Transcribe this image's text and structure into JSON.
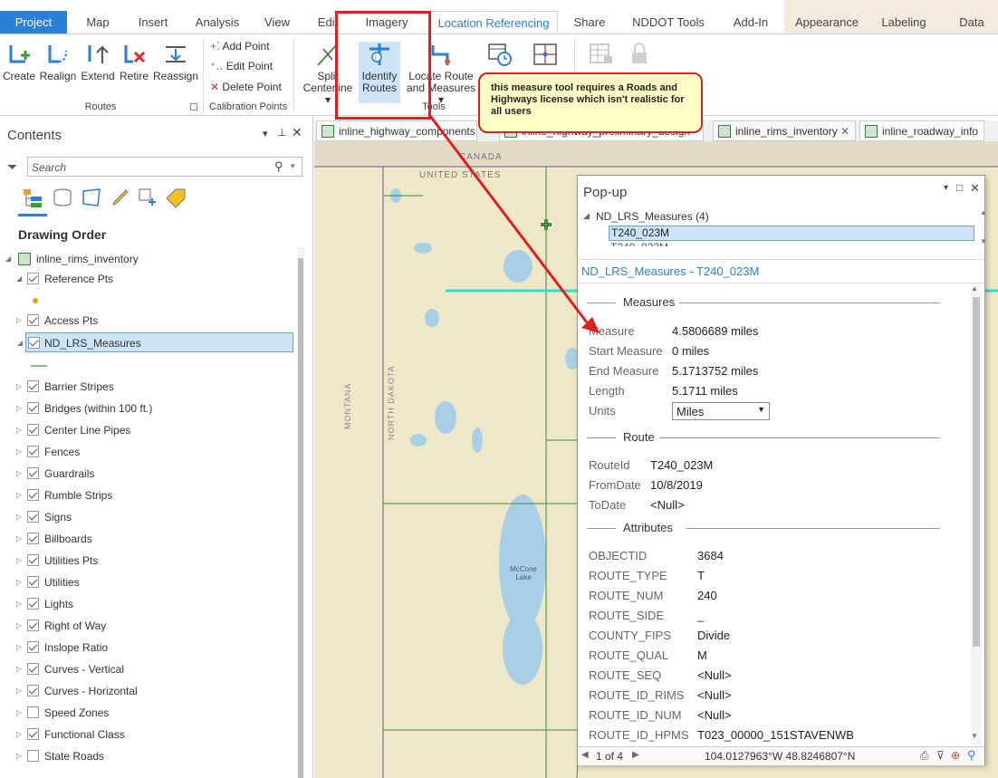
{
  "tabs": [
    "Project",
    "Map",
    "Insert",
    "Analysis",
    "View",
    "Edit",
    "Imagery",
    "Location Referencing",
    "Share",
    "NDDOT Tools",
    "Add-In",
    "Appearance",
    "Labeling",
    "Data"
  ],
  "ribbon": {
    "routes": [
      "Create",
      "Realign",
      "Extend",
      "Retire",
      "Reassign"
    ],
    "routes_group": "Routes",
    "calib": [
      "Add Point",
      "Edit Point",
      "Delete Point"
    ],
    "calib_group": "Calibration Points",
    "split": [
      "Split",
      "Centerline"
    ],
    "identify": [
      "Identify",
      "Routes"
    ],
    "locate": [
      "Locate Route",
      "and Measures"
    ],
    "tools_group": "Tools"
  },
  "callout": "this measure tool requires a Roads and Highways license which isn't realistic for all users",
  "contents": {
    "title": "Contents",
    "search_placeholder": "Search",
    "drawing_order": "Drawing Order",
    "map_name": "inline_rims_inventory",
    "layers": [
      {
        "label": "Reference Pts",
        "checked": true,
        "expanded": true
      },
      {
        "label": "Access Pts",
        "checked": true
      },
      {
        "label": "ND_LRS_Measures",
        "checked": true,
        "expanded": true,
        "selected": true
      },
      {
        "label": "Barrier Stripes",
        "checked": true
      },
      {
        "label": "Bridges (within 100 ft.)",
        "checked": true
      },
      {
        "label": "Center Line Pipes",
        "checked": true
      },
      {
        "label": "Fences",
        "checked": true
      },
      {
        "label": "Guardrails",
        "checked": true
      },
      {
        "label": "Rumble Strips",
        "checked": true
      },
      {
        "label": "Signs",
        "checked": true
      },
      {
        "label": "Billboards",
        "checked": true
      },
      {
        "label": "Utilities Pts",
        "checked": true
      },
      {
        "label": "Utilities",
        "checked": true
      },
      {
        "label": "Lights",
        "checked": true
      },
      {
        "label": "Right of Way",
        "checked": true
      },
      {
        "label": "Inslope Ratio",
        "checked": true
      },
      {
        "label": "Curves - Vertical",
        "checked": true
      },
      {
        "label": "Curves - Horizontal",
        "checked": true
      },
      {
        "label": "Speed Zones",
        "checked": false
      },
      {
        "label": "Functional Class",
        "checked": true
      },
      {
        "label": "State Roads",
        "checked": false
      }
    ]
  },
  "map_tabs": [
    "inline_highway_components",
    "inline_highway_preliminary_design",
    "inline_rims_inventory",
    "inline_roadway_info"
  ],
  "map_labels": {
    "canada": "CANADA",
    "us": "UNITED STATES",
    "montana": "MONTANA",
    "north_dakota": "NORTH DAKOTA",
    "lake": "McCone Lake"
  },
  "popup": {
    "title": "Pop-up",
    "tree_root": "ND_LRS_Measures  (4)",
    "tree_sel": "T240_023M",
    "header": "ND_LRS_Measures - T240_023M",
    "measures_title": "Measures",
    "measures": [
      {
        "label": "Measure",
        "value": "4.5806689 miles"
      },
      {
        "label": "Start Measure",
        "value": "0 miles"
      },
      {
        "label": "End Measure",
        "value": "5.1713752 miles"
      },
      {
        "label": "Length",
        "value": "5.1711 miles"
      }
    ],
    "units_label": "Units",
    "units_value": "Miles",
    "route_title": "Route",
    "route": [
      {
        "label": "RouteId",
        "value": "T240_023M"
      },
      {
        "label": "FromDate",
        "value": "10/8/2019"
      },
      {
        "label": "ToDate",
        "value": "<Null>"
      }
    ],
    "attr_title": "Attributes",
    "attributes": [
      {
        "label": "OBJECTID",
        "value": "3684"
      },
      {
        "label": "ROUTE_TYPE",
        "value": "T"
      },
      {
        "label": "ROUTE_NUM",
        "value": "240"
      },
      {
        "label": "ROUTE_SIDE",
        "value": "_"
      },
      {
        "label": "COUNTY_FIPS",
        "value": "Divide"
      },
      {
        "label": "ROUTE_QUAL",
        "value": "M"
      },
      {
        "label": "ROUTE_SEQ",
        "value": "<Null>"
      },
      {
        "label": "ROUTE_ID_RIMS",
        "value": "<Null>"
      },
      {
        "label": "ROUTE_ID_NUM",
        "value": "<Null>"
      },
      {
        "label": "ROUTE_ID_HPMS",
        "value": "T023_00000_151STAVENWB"
      }
    ],
    "pager": "1 of 4",
    "coords": "104.0127963°W 48.8246807°N"
  }
}
